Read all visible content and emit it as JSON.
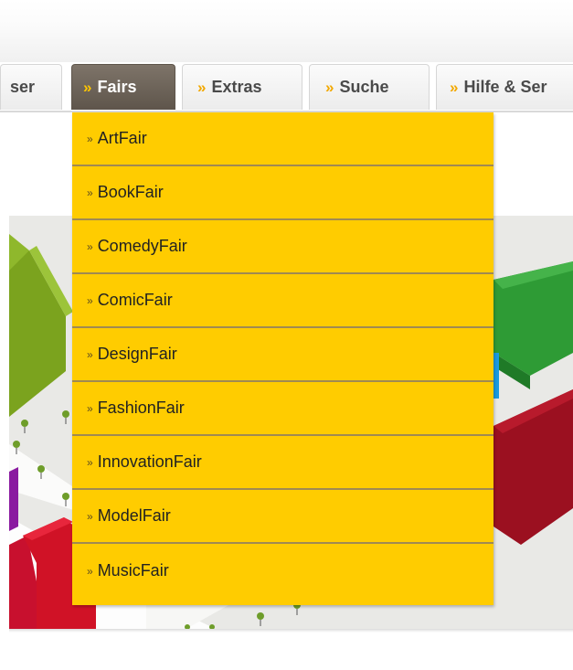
{
  "nav": {
    "tabs": [
      {
        "label": "ser",
        "marker": "",
        "active": false
      },
      {
        "label": "Fairs",
        "marker": "»",
        "active": true
      },
      {
        "label": "Extras",
        "marker": "»",
        "active": false
      },
      {
        "label": "Suche",
        "marker": "»",
        "active": false
      },
      {
        "label": "Hilfe & Ser",
        "marker": "»",
        "active": false
      }
    ]
  },
  "dropdown": {
    "marker": "»",
    "items": [
      "ArtFair",
      "BookFair",
      "ComedyFair",
      "ComicFair",
      "DesignFair",
      "FashionFair",
      "InnovationFair",
      "ModelFair",
      "MusicFair"
    ]
  },
  "colors": {
    "dropdown_bg": "#ffcc00",
    "active_tab": "#6e6459",
    "marker": "#f2a800"
  }
}
